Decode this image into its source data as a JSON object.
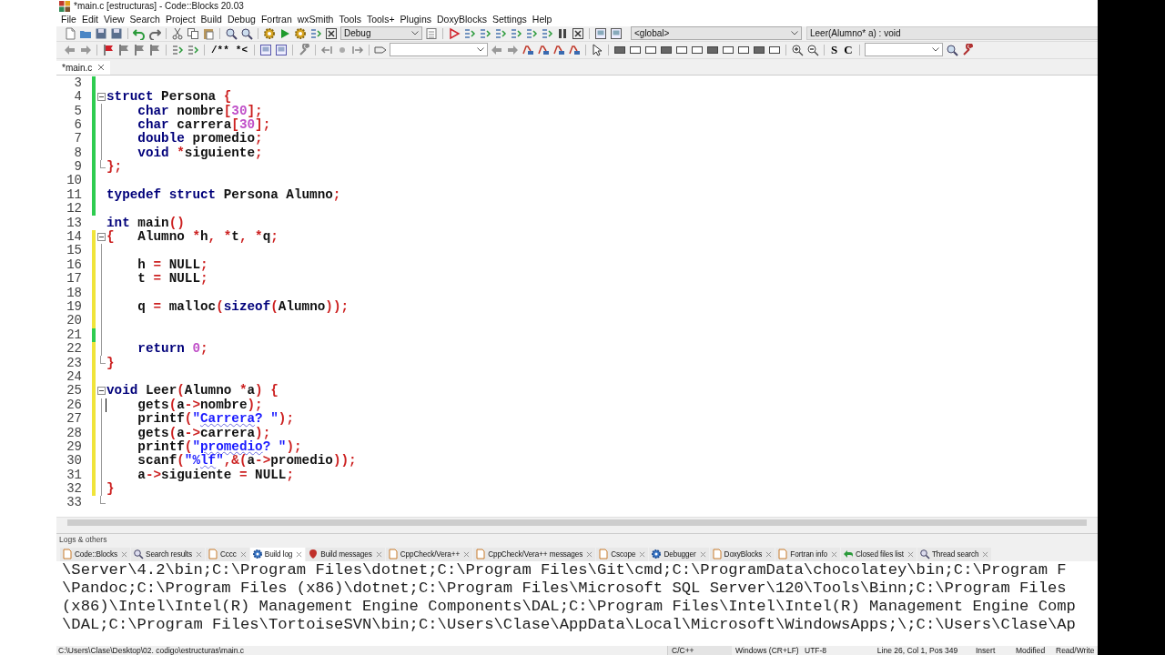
{
  "window": {
    "title": "*main.c [estructuras] - Code::Blocks 20.03"
  },
  "menu": [
    "File",
    "Edit",
    "View",
    "Search",
    "Project",
    "Build",
    "Debug",
    "Fortran",
    "wxSmith",
    "Tools",
    "Tools+",
    "Plugins",
    "DoxyBlocks",
    "Settings",
    "Help"
  ],
  "toolbar": {
    "build_target": "Debug",
    "scope": "<global>",
    "function": "Leer(Alumno* a) : void",
    "comment_buttons": [
      "/**",
      "*<"
    ],
    "search_buttons": [
      "S",
      "C"
    ]
  },
  "editor_tabs": [
    {
      "label": "*main.c",
      "selected": true
    }
  ],
  "code_lines": [
    {
      "number": "3",
      "color": "#2ecc50",
      "fold_start": false,
      "fold_end": false
    },
    {
      "number": "4",
      "color": "#2ecc50",
      "fold_start": true,
      "fold_end": false,
      "tokens": [
        {
          "text": "struct",
          "kind": "k"
        },
        {
          "text": " Persona ",
          "kind": "i"
        },
        {
          "text": "{",
          "kind": "o"
        }
      ]
    },
    {
      "number": "5",
      "color": "#2ecc50",
      "fold_start": false,
      "fold_end": false,
      "tokens": [
        {
          "text": "    char",
          "kind": "k"
        },
        {
          "text": " nombre",
          "kind": "i"
        },
        {
          "text": "[",
          "kind": "o"
        },
        {
          "text": "30",
          "kind": "n"
        },
        {
          "text": "];",
          "kind": "o"
        }
      ]
    },
    {
      "number": "6",
      "color": "#2ecc50",
      "fold_start": false,
      "fold_end": false,
      "tokens": [
        {
          "text": "    char",
          "kind": "k"
        },
        {
          "text": " carrera",
          "kind": "i"
        },
        {
          "text": "[",
          "kind": "o"
        },
        {
          "text": "30",
          "kind": "n"
        },
        {
          "text": "];",
          "kind": "o"
        }
      ]
    },
    {
      "number": "7",
      "color": "#2ecc50",
      "fold_start": false,
      "fold_end": false,
      "tokens": [
        {
          "text": "    double",
          "kind": "k"
        },
        {
          "text": " promedio",
          "kind": "i"
        },
        {
          "text": ";",
          "kind": "o"
        }
      ]
    },
    {
      "number": "8",
      "color": "#2ecc50",
      "fold_start": false,
      "fold_end": false,
      "tokens": [
        {
          "text": "    void",
          "kind": "k"
        },
        {
          "text": " *",
          "kind": "o"
        },
        {
          "text": "siguiente",
          "kind": "i"
        },
        {
          "text": ";",
          "kind": "o"
        }
      ]
    },
    {
      "number": "9",
      "color": "#2ecc50",
      "fold_start": false,
      "fold_end": true,
      "tokens": [
        {
          "text": "};",
          "kind": "o"
        }
      ]
    },
    {
      "number": "10",
      "color": "#2ecc50",
      "fold_start": false,
      "fold_end": false
    },
    {
      "number": "11",
      "color": "#2ecc50",
      "fold_start": false,
      "fold_end": false,
      "tokens": [
        {
          "text": "typedef",
          "kind": "k"
        },
        {
          "text": " struct",
          "kind": "k"
        },
        {
          "text": " Persona Alumno",
          "kind": "i"
        },
        {
          "text": ";",
          "kind": "o"
        }
      ]
    },
    {
      "number": "12",
      "color": "#2ecc50",
      "fold_start": false,
      "fold_end": false
    },
    {
      "number": "13",
      "fold_start": false,
      "fold_end": false,
      "tokens": [
        {
          "text": "int",
          "kind": "k"
        },
        {
          "text": " main",
          "kind": "i"
        },
        {
          "text": "()",
          "kind": "o"
        }
      ]
    },
    {
      "number": "14",
      "color": "#f0e43a",
      "fold_start": true,
      "fold_end": false,
      "tokens": [
        {
          "text": "{",
          "kind": "o"
        },
        {
          "text": "   Alumno ",
          "kind": "i"
        },
        {
          "text": "*",
          "kind": "o"
        },
        {
          "text": "h",
          "kind": "i"
        },
        {
          "text": ",",
          "kind": "o"
        },
        {
          "text": " *",
          "kind": "o"
        },
        {
          "text": "t",
          "kind": "i"
        },
        {
          "text": ",",
          "kind": "o"
        },
        {
          "text": " *",
          "kind": "o"
        },
        {
          "text": "q",
          "kind": "i"
        },
        {
          "text": ";",
          "kind": "o"
        }
      ]
    },
    {
      "number": "15",
      "color": "#f0e43a",
      "fold_start": false,
      "fold_end": false
    },
    {
      "number": "16",
      "color": "#f0e43a",
      "fold_start": false,
      "fold_end": false,
      "tokens": [
        {
          "text": "    h ",
          "kind": "i"
        },
        {
          "text": "=",
          "kind": "o"
        },
        {
          "text": " NULL",
          "kind": "i"
        },
        {
          "text": ";",
          "kind": "o"
        }
      ]
    },
    {
      "number": "17",
      "color": "#f0e43a",
      "fold_start": false,
      "fold_end": false,
      "tokens": [
        {
          "text": "    t ",
          "kind": "i"
        },
        {
          "text": "=",
          "kind": "o"
        },
        {
          "text": " NULL",
          "kind": "i"
        },
        {
          "text": ";",
          "kind": "o"
        }
      ]
    },
    {
      "number": "18",
      "color": "#f0e43a",
      "fold_start": false,
      "fold_end": false
    },
    {
      "number": "19",
      "color": "#f0e43a",
      "fold_start": false,
      "fold_end": false,
      "tokens": [
        {
          "text": "    q ",
          "kind": "i"
        },
        {
          "text": "=",
          "kind": "o"
        },
        {
          "text": " malloc",
          "kind": "i"
        },
        {
          "text": "(",
          "kind": "o"
        },
        {
          "text": "sizeof",
          "kind": "k"
        },
        {
          "text": "(",
          "kind": "o"
        },
        {
          "text": "Alumno",
          "kind": "i"
        },
        {
          "text": "));",
          "kind": "o"
        }
      ]
    },
    {
      "number": "20",
      "color": "#f0e43a",
      "fold_start": false,
      "fold_end": false
    },
    {
      "number": "21",
      "color": "#2ecc50",
      "fold_start": false,
      "fold_end": false
    },
    {
      "number": "22",
      "color": "#f0e43a",
      "fold_start": false,
      "fold_end": false,
      "tokens": [
        {
          "text": "    return",
          "kind": "k"
        },
        {
          "text": " 0",
          "kind": "n"
        },
        {
          "text": ";",
          "kind": "o"
        }
      ]
    },
    {
      "number": "23",
      "color": "#f0e43a",
      "fold_start": false,
      "fold_end": true,
      "tokens": [
        {
          "text": "}",
          "kind": "o"
        }
      ]
    },
    {
      "number": "24",
      "color": "#f0e43a",
      "fold_start": false,
      "fold_end": false
    },
    {
      "number": "25",
      "color": "#f0e43a",
      "fold_start": true,
      "fold_end": false,
      "tokens": [
        {
          "text": "void",
          "kind": "k"
        },
        {
          "text": " Leer",
          "kind": "i"
        },
        {
          "text": "(",
          "kind": "o"
        },
        {
          "text": "Alumno ",
          "kind": "i"
        },
        {
          "text": "*",
          "kind": "o"
        },
        {
          "text": "a",
          "kind": "i"
        },
        {
          "text": ")",
          "kind": "o"
        },
        {
          "text": " {",
          "kind": "o"
        }
      ]
    },
    {
      "number": "26",
      "color": "#f0e43a",
      "fold_start": false,
      "fold_end": false,
      "caret": true,
      "tokens": [
        {
          "text": "    gets",
          "kind": "i"
        },
        {
          "text": "(",
          "kind": "o"
        },
        {
          "text": "a",
          "kind": "i"
        },
        {
          "text": "->",
          "kind": "o"
        },
        {
          "text": "nombre",
          "kind": "i"
        },
        {
          "text": ");",
          "kind": "o"
        }
      ]
    },
    {
      "number": "27",
      "color": "#f0e43a",
      "fold_start": false,
      "fold_end": false,
      "tokens": [
        {
          "text": "    printf",
          "kind": "i"
        },
        {
          "text": "(",
          "kind": "o"
        },
        {
          "text": "\"",
          "kind": "s"
        },
        {
          "text": "Carrera",
          "kind": "sp"
        },
        {
          "text": "? \"",
          "kind": "s"
        },
        {
          "text": ");",
          "kind": "o"
        }
      ]
    },
    {
      "number": "28",
      "color": "#f0e43a",
      "fold_start": false,
      "fold_end": false,
      "tokens": [
        {
          "text": "    gets",
          "kind": "i"
        },
        {
          "text": "(",
          "kind": "o"
        },
        {
          "text": "a",
          "kind": "i"
        },
        {
          "text": "->",
          "kind": "o"
        },
        {
          "text": "carrera",
          "kind": "i"
        },
        {
          "text": ");",
          "kind": "o"
        }
      ]
    },
    {
      "number": "29",
      "color": "#f0e43a",
      "fold_start": false,
      "fold_end": false,
      "tokens": [
        {
          "text": "    printf",
          "kind": "i"
        },
        {
          "text": "(",
          "kind": "o"
        },
        {
          "text": "\"",
          "kind": "s"
        },
        {
          "text": "promedio",
          "kind": "sp"
        },
        {
          "text": "? \"",
          "kind": "s"
        },
        {
          "text": ");",
          "kind": "o"
        }
      ]
    },
    {
      "number": "30",
      "color": "#f0e43a",
      "fold_start": false,
      "fold_end": false,
      "tokens": [
        {
          "text": "    scanf",
          "kind": "i"
        },
        {
          "text": "(",
          "kind": "o"
        },
        {
          "text": "\"%",
          "kind": "s"
        },
        {
          "text": "lf",
          "kind": "sp"
        },
        {
          "text": "\"",
          "kind": "s"
        },
        {
          "text": ",&(",
          "kind": "o"
        },
        {
          "text": "a",
          "kind": "i"
        },
        {
          "text": "->",
          "kind": "o"
        },
        {
          "text": "promedio",
          "kind": "i"
        },
        {
          "text": "));",
          "kind": "o"
        }
      ]
    },
    {
      "number": "31",
      "color": "#f0e43a",
      "fold_start": false,
      "fold_end": false,
      "tokens": [
        {
          "text": "    a",
          "kind": "i"
        },
        {
          "text": "->",
          "kind": "o"
        },
        {
          "text": "siguiente ",
          "kind": "i"
        },
        {
          "text": "=",
          "kind": "o"
        },
        {
          "text": " NULL",
          "kind": "i"
        },
        {
          "text": ";",
          "kind": "o"
        }
      ]
    },
    {
      "number": "32",
      "color": "#f0e43a",
      "fold_start": false,
      "fold_end": false,
      "tokens": [
        {
          "text": "}",
          "kind": "o"
        }
      ]
    },
    {
      "number": "33",
      "fold_start": false,
      "fold_end": true
    }
  ],
  "logs": {
    "title": "Logs & others",
    "tabs": [
      {
        "label": "Code::Blocks",
        "selected": false
      },
      {
        "label": "Search results",
        "selected": false
      },
      {
        "label": "Cccc",
        "selected": false
      },
      {
        "label": "Build log",
        "selected": true
      },
      {
        "label": "Build messages",
        "selected": false
      },
      {
        "label": "CppCheck/Vera++",
        "selected": false
      },
      {
        "label": "CppCheck/Vera++ messages",
        "selected": false
      },
      {
        "label": "Cscope",
        "selected": false
      },
      {
        "label": "Debugger",
        "selected": false
      },
      {
        "label": "DoxyBlocks",
        "selected": false
      },
      {
        "label": "Fortran info",
        "selected": false
      },
      {
        "label": "Closed files list",
        "selected": false
      },
      {
        "label": "Thread search",
        "selected": false
      }
    ],
    "lines": [
      "\\Server\\4.2\\bin;C:\\Program Files\\dotnet;C:\\Program Files\\Git\\cmd;C:\\ProgramData\\chocolatey\\bin;C:\\Program F",
      "\\Pandoc;C:\\Program Files (x86)\\dotnet;C:\\Program Files\\Microsoft SQL Server\\120\\Tools\\Binn;C:\\Program Files",
      "(x86)\\Intel\\Intel(R) Management Engine Components\\DAL;C:\\Program Files\\Intel\\Intel(R) Management Engine Comp",
      "\\DAL;C:\\Program Files\\TortoiseSVN\\bin;C:\\Users\\Clase\\AppData\\Local\\Microsoft\\WindowsApps;\\;C:\\Users\\Clase\\Ap"
    ]
  },
  "status_bar": {
    "path": "C:\\Users\\Clase\\Desktop\\02. codigo\\estructuras\\main.c",
    "cells": [
      "C/C++",
      "Windows (CR+LF)",
      "UTF-8",
      "Line 26, Col 1, Pos 349",
      "Insert",
      "Modified",
      "Read/Write"
    ]
  }
}
